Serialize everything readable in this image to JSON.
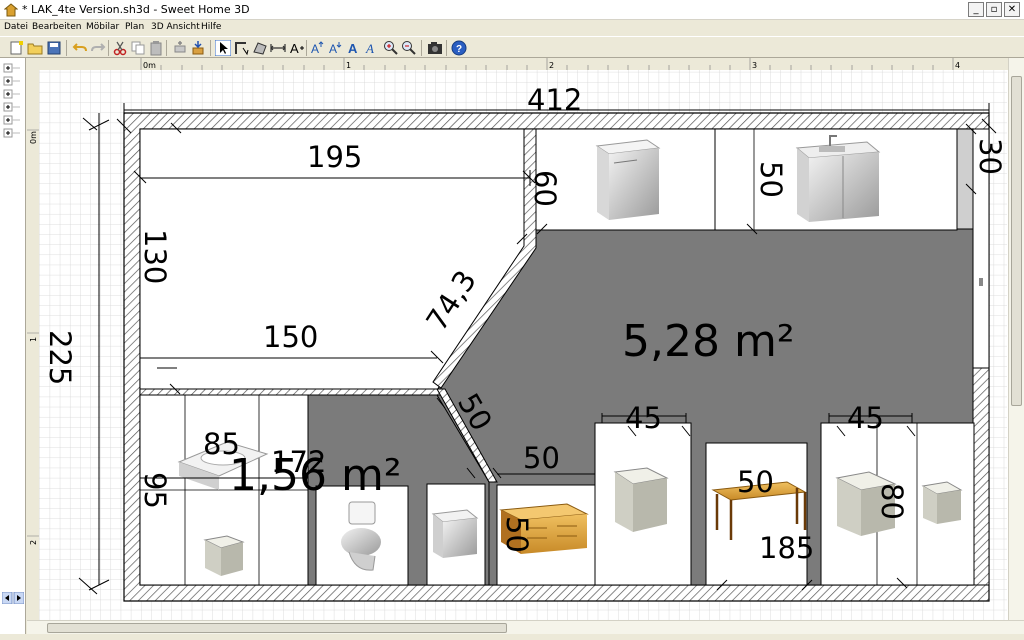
{
  "window": {
    "title": "* LAK_4te Version.sh3d - Sweet Home 3D",
    "minimize": "_",
    "maximize": "▫",
    "close": "✕"
  },
  "menu": [
    "Datei",
    "Bearbeiten",
    "Möbilar",
    "Plan",
    "3D Ansicht",
    "Hilfe"
  ],
  "toolbar": {
    "icons": [
      "new-icon",
      "open-icon",
      "save-icon",
      "undo-icon",
      "redo-icon",
      "cut-icon",
      "copy-icon",
      "paste-icon",
      "add-furniture-icon",
      "import-furniture-icon",
      "select-icon",
      "create-walls-icon",
      "create-rooms-icon",
      "create-dimensions-icon",
      "add-text-icon",
      "zoom-text-icon",
      "text-style-icon",
      "bold-text-icon",
      "italic-text-icon",
      "zoom-in-icon",
      "zoom-out-icon",
      "camera-icon",
      "help-icon"
    ]
  },
  "ruler": {
    "x_labels": [
      "0m",
      "1",
      "2",
      "3",
      "4"
    ],
    "y_labels": [
      "0m",
      "1",
      "2"
    ]
  },
  "plan": {
    "dimensions": {
      "top_total": "412",
      "left_total": "225",
      "inner_top": "195",
      "inner_left": "130",
      "mid_width": "150",
      "diag_upper_short": "60",
      "diag_length": "74,3",
      "right_depth": "30",
      "sink_depth": "50",
      "lower_diag": "50",
      "lower_mid": "50",
      "cab_width_1": "45",
      "cab_width_2": "45",
      "table_depth": "50",
      "table_width": "185",
      "cab_depth_right": "80",
      "desk_depth": "50",
      "bath_width": "85",
      "bath_height": "95",
      "bath_extra": "172"
    },
    "rooms": {
      "main_area": "5,28 m²",
      "bath_area": "1,56 m²"
    }
  }
}
